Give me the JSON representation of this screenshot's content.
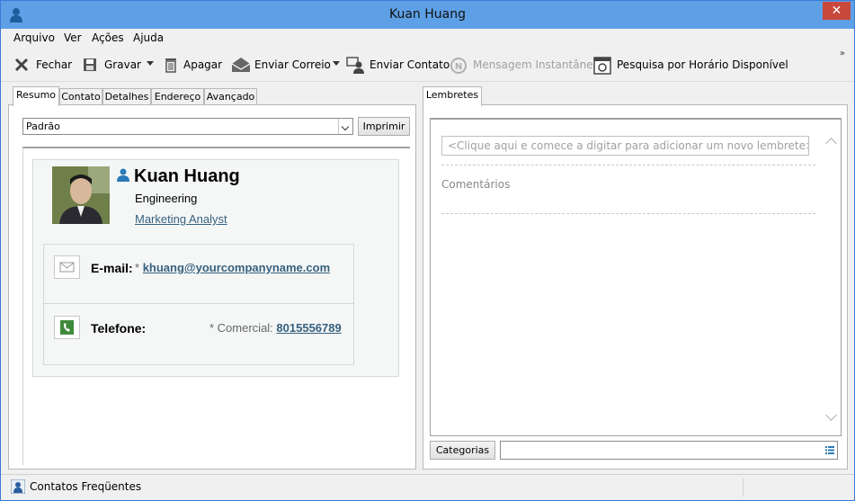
{
  "window": {
    "title": "Kuan Huang",
    "close_glyph": "✕"
  },
  "menu": [
    "Arquivo",
    "Ver",
    "Ações",
    "Ajuda"
  ],
  "toolbar": {
    "close": "Fechar",
    "save": "Gravar",
    "delete": "Apagar",
    "send_mail": "Enviar Correio",
    "send_contact": "Enviar Contato",
    "instant_message": "Mensagem Instantânea",
    "schedule": "Pesquisa por Horário Disponível",
    "overflow": "»"
  },
  "left_tabs": [
    "Resumo",
    "Contato",
    "Detalhes",
    "Endereço",
    "Avançado"
  ],
  "view_select": {
    "value": "Padrão"
  },
  "print_button": "Imprimir",
  "contact": {
    "name": "Kuan Huang",
    "company": "Engineering",
    "job_title": "Marketing Analyst",
    "email_label": "E-mail:",
    "email_star": "*",
    "email": "khuang@yourcompanyname.com",
    "phone_label": "Telefone:",
    "phone_type": "* Comercial:",
    "phone": "8015556789"
  },
  "right_tabs": [
    "Lembretes"
  ],
  "reminder": {
    "placeholder": "<Clique aqui e comece a digitar para adicionar um novo lembrete>"
  },
  "comments_label": "Comentários",
  "categories_button": "Categorias",
  "status": {
    "label": "Contatos Freqüentes"
  },
  "colors": {
    "title_bar": "#5ea0e6",
    "link": "#35607d",
    "close": "#c9483c"
  }
}
